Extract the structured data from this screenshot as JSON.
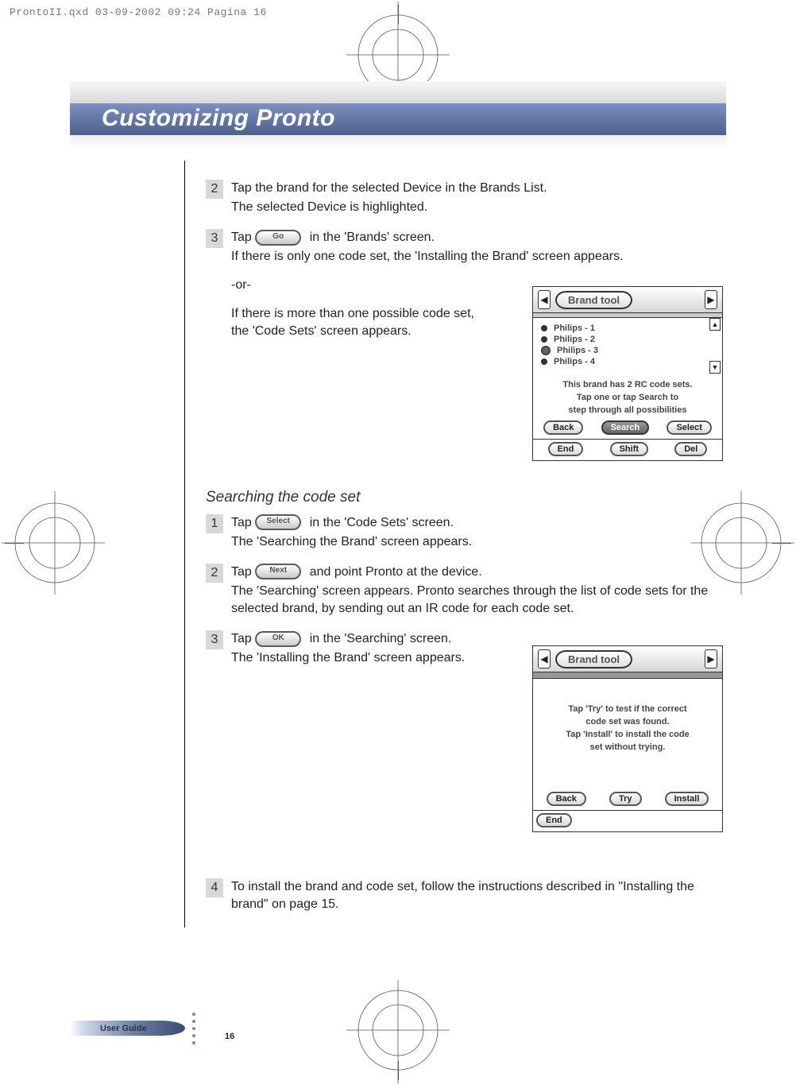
{
  "meta": {
    "filename_header": "ProntoII.qxd  03-09-2002  09:24  Pagina 16"
  },
  "title": "Customizing Pronto",
  "section1": {
    "step2": {
      "num": "2",
      "line1": "Tap the brand for the selected Device in the Brands List.",
      "line2": "The selected Device is highlighted."
    },
    "step3": {
      "num": "3",
      "pill": "Go",
      "line1a": "Tap ",
      "line1b": " in the 'Brands' screen.",
      "line2": "If there is only one code set, the 'Installing the Brand' screen appears.",
      "or": "-or-",
      "line3": "If there is more than one possible code set, the 'Code Sets' screen appears."
    }
  },
  "section2": {
    "heading": "Searching the code set",
    "step1": {
      "num": "1",
      "pill": "Select",
      "line1a": "Tap ",
      "line1b": " in the 'Code Sets' screen.",
      "line2": "The 'Searching the Brand' screen appears."
    },
    "step2": {
      "num": "2",
      "pill": "Next",
      "line1a": "Tap ",
      "line1b": " and point Pronto at the device.",
      "line2": "The 'Searching' screen appears. Pronto searches through the list of code sets for the selected brand, by sending out an IR code for each code set."
    },
    "step3": {
      "num": "3",
      "pill": "OK",
      "line1a": "Tap ",
      "line1b": " in the 'Searching' screen.",
      "line2": "The 'Installing the Brand' screen appears."
    },
    "step4": {
      "num": "4",
      "line1": "To install the brand and code set, follow the instructions described in \"Installing the brand\" on page 15."
    }
  },
  "screens": {
    "header_label": "Brand tool",
    "s1": {
      "items": [
        "Philips - 1",
        "Philips - 2",
        "Philips - 3",
        "Philips - 4"
      ],
      "msg1": "This brand has 2 RC code sets.",
      "msg2": "Tap one or tap Search to",
      "msg3": "step through all possibilities",
      "btns": [
        "Back",
        "Search",
        "Select"
      ],
      "btns2": [
        "End",
        "Shift",
        "Del"
      ]
    },
    "s2": {
      "msg1": "Tap 'Try' to test if the correct",
      "msg2": "code set was found.",
      "msg3": "Tap 'Install' to install the code",
      "msg4": "set without trying.",
      "btns": [
        "Back",
        "Try",
        "Install"
      ],
      "btns2": [
        "End"
      ]
    }
  },
  "footer": {
    "label": "User Guide",
    "page": "16"
  }
}
